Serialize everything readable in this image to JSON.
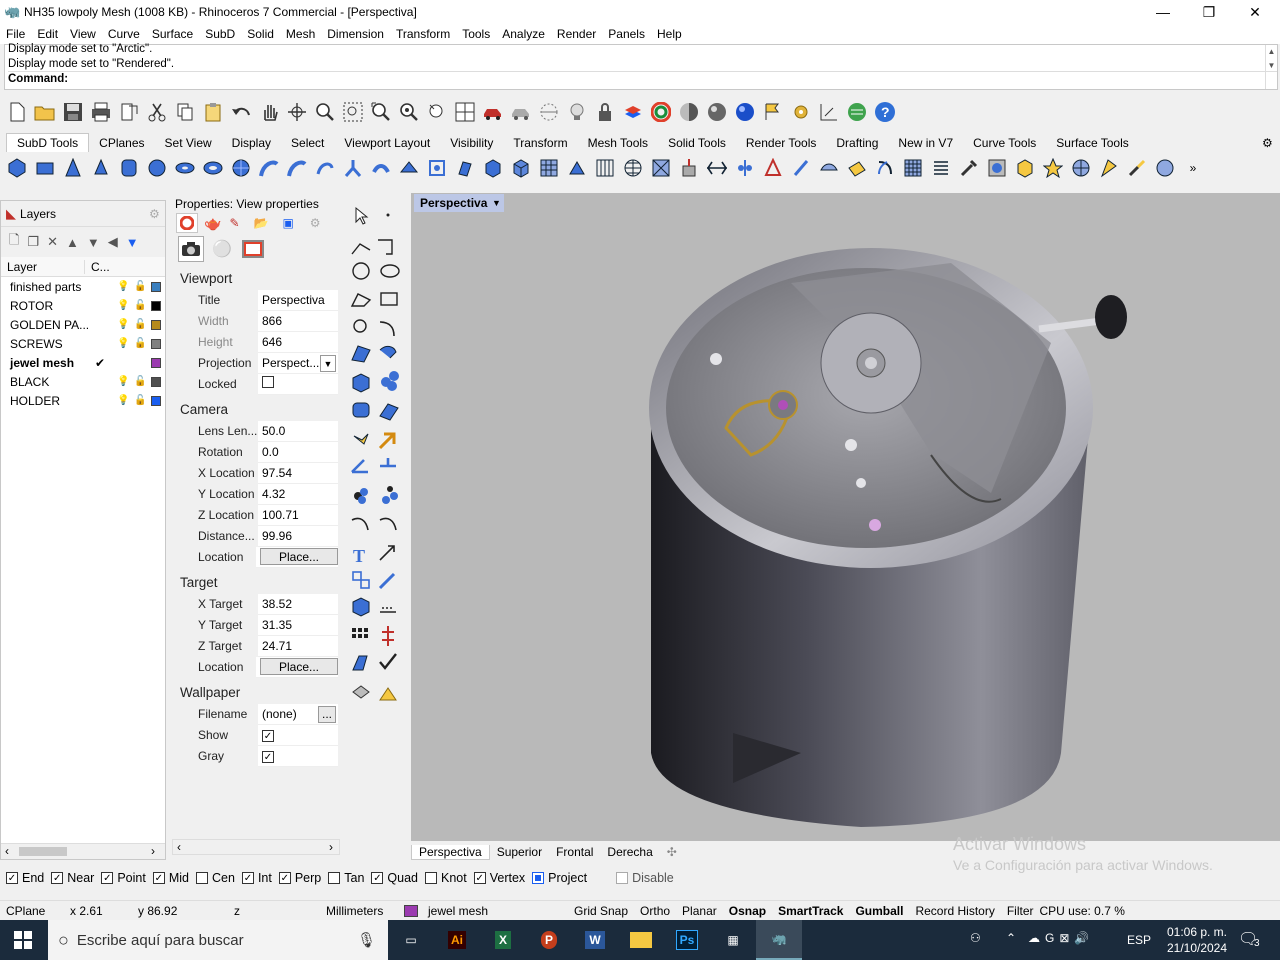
{
  "window": {
    "title": "NH35 lowpoly Mesh (1008 KB) - Rhinoceros 7 Commercial - [Perspectiva]"
  },
  "menu": [
    "File",
    "Edit",
    "View",
    "Curve",
    "Surface",
    "SubD",
    "Solid",
    "Mesh",
    "Dimension",
    "Transform",
    "Tools",
    "Analyze",
    "Render",
    "Panels",
    "Help"
  ],
  "command": {
    "line1": "Display mode set to \"Arctic\".",
    "line2": "Display mode set to \"Rendered\".",
    "prompt": "Command:"
  },
  "tabs": [
    "SubD Tools",
    "CPlanes",
    "Set View",
    "Display",
    "Select",
    "Viewport Layout",
    "Visibility",
    "Transform",
    "Mesh Tools",
    "Solid Tools",
    "Render Tools",
    "Drafting",
    "New in V7",
    "Curve Tools",
    "Surface Tools"
  ],
  "layers": {
    "panel_title": "Layers",
    "col_layer": "Layer",
    "col_current": "C...",
    "rows": [
      {
        "name": "finished parts",
        "color": "#3a7fbf",
        "current": false
      },
      {
        "name": "ROTOR",
        "color": "#000000",
        "current": false
      },
      {
        "name": "GOLDEN PA...",
        "color": "#b58a1c",
        "current": false
      },
      {
        "name": "SCREWS",
        "color": "#808080",
        "current": false
      },
      {
        "name": "jewel mesh",
        "color": "#9b3bb0",
        "current": true
      },
      {
        "name": "BLACK",
        "color": "#505050",
        "current": false
      },
      {
        "name": "HOLDER",
        "color": "#1a5ef0",
        "current": false
      }
    ]
  },
  "properties": {
    "title": "Properties: View properties",
    "viewport": {
      "section": "Viewport",
      "title_label": "Title",
      "title": "Perspectiva",
      "width_label": "Width",
      "width": "866",
      "height_label": "Height",
      "height": "646",
      "projection_label": "Projection",
      "projection": "Perspect...",
      "locked_label": "Locked"
    },
    "camera": {
      "section": "Camera",
      "lens_label": "Lens Len...",
      "lens": "50.0",
      "rotation_label": "Rotation",
      "rotation": "0.0",
      "xloc_label": "X Location",
      "xloc": "97.54",
      "yloc_label": "Y Location",
      "yloc": "4.32",
      "zloc_label": "Z Location",
      "zloc": "100.71",
      "dist_label": "Distance...",
      "dist": "99.96",
      "location_label": "Location",
      "place": "Place..."
    },
    "target": {
      "section": "Target",
      "x_label": "X Target",
      "x": "38.52",
      "y_label": "Y Target",
      "y": "31.35",
      "z_label": "Z Target",
      "z": "24.71",
      "location_label": "Location",
      "place": "Place..."
    },
    "wallpaper": {
      "section": "Wallpaper",
      "filename_label": "Filename",
      "filename": "(none)",
      "browse": "...",
      "show_label": "Show",
      "gray_label": "Gray"
    }
  },
  "viewport": {
    "name": "Perspectiva",
    "tabs": [
      "Perspectiva",
      "Superior",
      "Frontal",
      "Derecha"
    ]
  },
  "watermark": {
    "line1": "Activar Windows",
    "line2": "Ve a Configuración para activar Windows."
  },
  "osnaps": [
    {
      "label": "End",
      "checked": true
    },
    {
      "label": "Near",
      "checked": true
    },
    {
      "label": "Point",
      "checked": true
    },
    {
      "label": "Mid",
      "checked": true
    },
    {
      "label": "Cen",
      "checked": false
    },
    {
      "label": "Int",
      "checked": true
    },
    {
      "label": "Perp",
      "checked": true
    },
    {
      "label": "Tan",
      "checked": false
    },
    {
      "label": "Quad",
      "checked": true
    },
    {
      "label": "Knot",
      "checked": false
    },
    {
      "label": "Vertex",
      "checked": true
    },
    {
      "label": "Project",
      "checked": true
    },
    {
      "label": "Disable",
      "checked": false
    }
  ],
  "status": {
    "cplane": "CPlane",
    "x": "x 2.61",
    "y": "y 86.92",
    "z": "z",
    "units": "Millimeters",
    "layer": "jewel mesh",
    "layer_color": "#9b3bb0",
    "grid_snap": "Grid Snap",
    "ortho": "Ortho",
    "planar": "Planar",
    "osnap": "Osnap",
    "smarttrack": "SmartTrack",
    "gumball": "Gumball",
    "record_history": "Record History",
    "filter": "Filter",
    "cpu": "CPU use: 0.7 %"
  },
  "taskbar": {
    "search_placeholder": "Escribe aquí para buscar",
    "lang": "ESP",
    "time": "01:06 p. m.",
    "date": "21/10/2024",
    "notifications": "3"
  }
}
